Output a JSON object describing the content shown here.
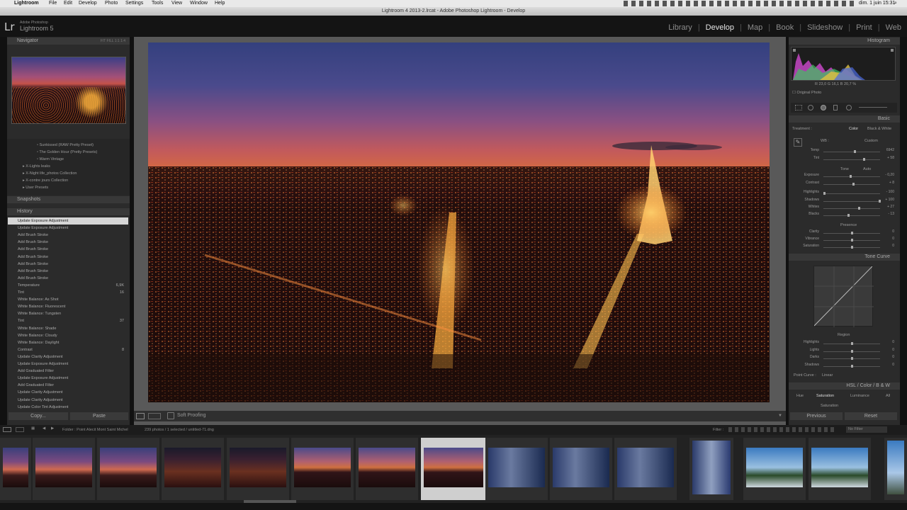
{
  "menubar": {
    "app": "Lightroom",
    "items": [
      "File",
      "Edit",
      "Develop",
      "Photo",
      "Settings",
      "Tools",
      "View",
      "Window",
      "Help"
    ],
    "clock": "dim. 1 juin  15:31"
  },
  "window_title": "Lightroom 4 2013-2.lrcat - Adobe Photoshop Lightroom - Develop",
  "identity": {
    "logo": "Lr",
    "sub1": "Adobe Photoshop",
    "sub2": "Lightroom 5"
  },
  "modules": [
    {
      "label": "Library",
      "active": false
    },
    {
      "label": "Develop",
      "active": true
    },
    {
      "label": "Map",
      "active": false
    },
    {
      "label": "Book",
      "active": false
    },
    {
      "label": "Slideshow",
      "active": false
    },
    {
      "label": "Print",
      "active": false
    },
    {
      "label": "Web",
      "active": false
    }
  ],
  "left": {
    "navigator_title": "Navigator",
    "navigator_zoom": "FIT   FILL   1:1   1:4",
    "presets": [
      "Sunkissed (RAW Pretty Preset)",
      "The Golden Hour (Pretty Presets)",
      "Warm Vintage",
      "X-Lights leaks",
      "X-Night life_photos Collection",
      "X-contre jours Collection",
      "User Presets"
    ],
    "snapshots_title": "Snapshots",
    "history_title": "History",
    "history": [
      {
        "label": "Update Exposure Adjustment",
        "v1": "",
        "v2": ""
      },
      {
        "label": "Update Exposure Adjustment",
        "v1": "",
        "v2": ""
      },
      {
        "label": "Add Brush Stroke",
        "v1": "",
        "v2": ""
      },
      {
        "label": "Add Brush Stroke",
        "v1": "",
        "v2": ""
      },
      {
        "label": "Add Brush Stroke",
        "v1": "",
        "v2": ""
      },
      {
        "label": "Add Brush Stroke",
        "v1": "",
        "v2": ""
      },
      {
        "label": "Add Brush Stroke",
        "v1": "",
        "v2": ""
      },
      {
        "label": "Add Brush Stroke",
        "v1": "",
        "v2": ""
      },
      {
        "label": "Add Brush Stroke",
        "v1": "",
        "v2": ""
      },
      {
        "label": "Temperature",
        "v1": "",
        "v2": "6,9K"
      },
      {
        "label": "Tint",
        "v1": "",
        "v2": "16"
      },
      {
        "label": "White Balance: As Shot",
        "v1": "",
        "v2": ""
      },
      {
        "label": "White Balance: Fluorescent",
        "v1": "",
        "v2": ""
      },
      {
        "label": "White Balance: Tungsten",
        "v1": "",
        "v2": ""
      },
      {
        "label": "Tint",
        "v1": "",
        "v2": "37"
      },
      {
        "label": "White Balance: Shade",
        "v1": "",
        "v2": ""
      },
      {
        "label": "White Balance: Cloudy",
        "v1": "",
        "v2": ""
      },
      {
        "label": "White Balance: Daylight",
        "v1": "",
        "v2": ""
      },
      {
        "label": "Contrast",
        "v1": "",
        "v2": "8"
      },
      {
        "label": "Update Clarity Adjustment",
        "v1": "",
        "v2": ""
      },
      {
        "label": "Update Exposure Adjustment",
        "v1": "",
        "v2": ""
      },
      {
        "label": "Add Graduated Filter",
        "v1": "",
        "v2": ""
      },
      {
        "label": "Update Exposure Adjustment",
        "v1": "",
        "v2": ""
      },
      {
        "label": "Add Graduated Filter",
        "v1": "",
        "v2": ""
      },
      {
        "label": "Update Clarity Adjustment",
        "v1": "",
        "v2": ""
      },
      {
        "label": "Update Clarity Adjustment",
        "v1": "",
        "v2": ""
      },
      {
        "label": "Update Color Tint Adjustment",
        "v1": "",
        "v2": ""
      }
    ],
    "copy_label": "Copy...",
    "paste_label": "Paste"
  },
  "toolbar": {
    "soft_proofing": "Soft Proofing"
  },
  "right": {
    "histogram_title": "Histogram",
    "rgb_readout": "R 23,0   G 16,1   B 20,7 %",
    "original_photo": "Original Photo",
    "basic_title": "Basic",
    "treatment_label": "Treatment :",
    "treatment_color": "Color",
    "treatment_bw": "Black & White",
    "wb_label": "WB :",
    "wb_value": "Custom",
    "tone_label": "Tone",
    "tone_auto": "Auto",
    "presence_label": "Presence",
    "sliders": [
      {
        "label": "Temp",
        "value": "6942",
        "pos": 0.55
      },
      {
        "label": "Tint",
        "value": "+ 58",
        "pos": 0.72
      },
      {
        "label": "Exposure",
        "value": "- 0,20",
        "pos": 0.48
      },
      {
        "label": "Contrast",
        "value": "+ 8",
        "pos": 0.52
      },
      {
        "label": "Highlights",
        "value": "- 100",
        "pos": 0.0
      },
      {
        "label": "Shadows",
        "value": "+ 100",
        "pos": 1.0
      },
      {
        "label": "Whites",
        "value": "+ 27",
        "pos": 0.63
      },
      {
        "label": "Blacks",
        "value": "- 13",
        "pos": 0.44
      },
      {
        "label": "Clarity",
        "value": "0",
        "pos": 0.5
      },
      {
        "label": "Vibrance",
        "value": "0",
        "pos": 0.5
      },
      {
        "label": "Saturation",
        "value": "0",
        "pos": 0.5
      }
    ],
    "tone_curve_title": "Tone Curve",
    "region_label": "Region",
    "region_sliders": [
      {
        "label": "Highlights",
        "value": "0",
        "pos": 0.5
      },
      {
        "label": "Lights",
        "value": "0",
        "pos": 0.5
      },
      {
        "label": "Darks",
        "value": "0",
        "pos": 0.5
      },
      {
        "label": "Shadows",
        "value": "0",
        "pos": 0.5
      }
    ],
    "point_curve_label": "Point Curve :",
    "point_curve_value": "Linear",
    "hsl_title": "HSL  /  Color  /  B & W",
    "hsl_tabs": [
      "Hue",
      "Saturation",
      "Luminance",
      "All"
    ],
    "saturation_label": "Saturation",
    "previous_label": "Previous",
    "reset_label": "Reset"
  },
  "filmbar": {
    "folder": "Folder : Point Alecit Mont Saint Michel",
    "count": "239 photos / 1 selected / untitled-71.dng",
    "filter_label": "Filter :",
    "filter_value": "No Filter"
  },
  "filmstrip": [
    {
      "type": "sunset-sky",
      "selected": false
    },
    {
      "type": "sunset-sky",
      "selected": false
    },
    {
      "type": "sunset-sky",
      "selected": false
    },
    {
      "type": "city-night",
      "selected": false
    },
    {
      "type": "city-night",
      "selected": false
    },
    {
      "type": "city-dusk",
      "selected": false
    },
    {
      "type": "city-dusk",
      "selected": false
    },
    {
      "type": "city-dusk",
      "selected": true
    },
    {
      "type": "room-blue",
      "selected": false
    },
    {
      "type": "room-blue",
      "selected": false
    },
    {
      "type": "room-blue",
      "selected": false
    },
    {
      "type": "room-portrait",
      "selected": false
    },
    {
      "type": "island-sky",
      "selected": false
    },
    {
      "type": "island-sky",
      "selected": false
    },
    {
      "type": "island-portrait",
      "selected": false
    }
  ]
}
